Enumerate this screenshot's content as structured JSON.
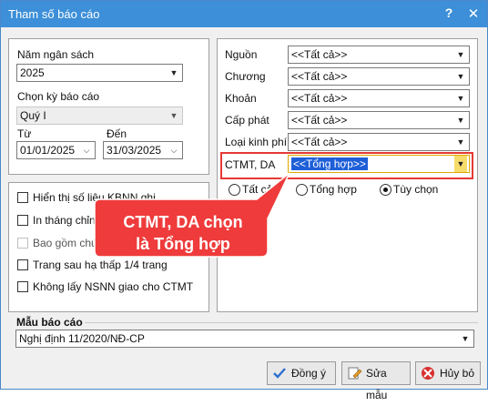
{
  "window": {
    "title": "Tham số báo cáo",
    "help_glyph": "?",
    "close_glyph": "✕"
  },
  "left": {
    "nam_ngan_sach_label": "Năm ngân sách",
    "nam_ngan_sach_value": "2025",
    "ky_bao_cao_label": "Chọn kỳ báo cáo",
    "ky_bao_cao_value": "Quý I",
    "tu_label": "Từ",
    "tu_value": "01/01/2025",
    "den_label": "Đến",
    "den_value": "31/03/2025",
    "checkboxes": [
      {
        "label": "Hiển thị số liệu KBNN ghi",
        "checked": false,
        "enabled": true
      },
      {
        "label": "In tháng chỉnh",
        "checked": false,
        "enabled": true
      },
      {
        "label": "Bao gồm chứng",
        "checked": false,
        "enabled": false
      },
      {
        "label": "Trang sau hạ thấp 1/4 trang",
        "checked": false,
        "enabled": true
      },
      {
        "label": "Không lấy NSNN giao cho CTMT",
        "checked": false,
        "enabled": true
      }
    ]
  },
  "right": {
    "rows": [
      {
        "label": "Nguồn",
        "value": "<<Tất cả>>"
      },
      {
        "label": "Chương",
        "value": "<<Tất cả>>"
      },
      {
        "label": "Khoản",
        "value": "<<Tất cả>>"
      },
      {
        "label": "Cấp phát",
        "value": "<<Tất cả>>"
      },
      {
        "label": "Loại kinh phí",
        "value": "<<Tất cả>>"
      }
    ],
    "ctmt_label": "CTMT, DA",
    "ctmt_value": "<<Tổng hợp>>",
    "radios": [
      {
        "label": "Tất cả",
        "selected": false
      },
      {
        "label": "Tổng hợp",
        "selected": false
      },
      {
        "label": "Tùy chọn",
        "selected": true
      }
    ]
  },
  "mau_bao_cao": {
    "label": "Mẫu báo cáo",
    "value": "Nghị định 11/2020/NĐ-CP"
  },
  "buttons": {
    "ok": "Đồng ý",
    "edit": "Sửa mẫu",
    "cancel": "Hủy bỏ"
  },
  "annotation": {
    "line1": "CTMT, DA chọn",
    "line2": "là Tổng hợp"
  },
  "colors": {
    "accent": "#3c8fd8",
    "highlight": "#e53935",
    "selection": "#1e5fd8"
  }
}
